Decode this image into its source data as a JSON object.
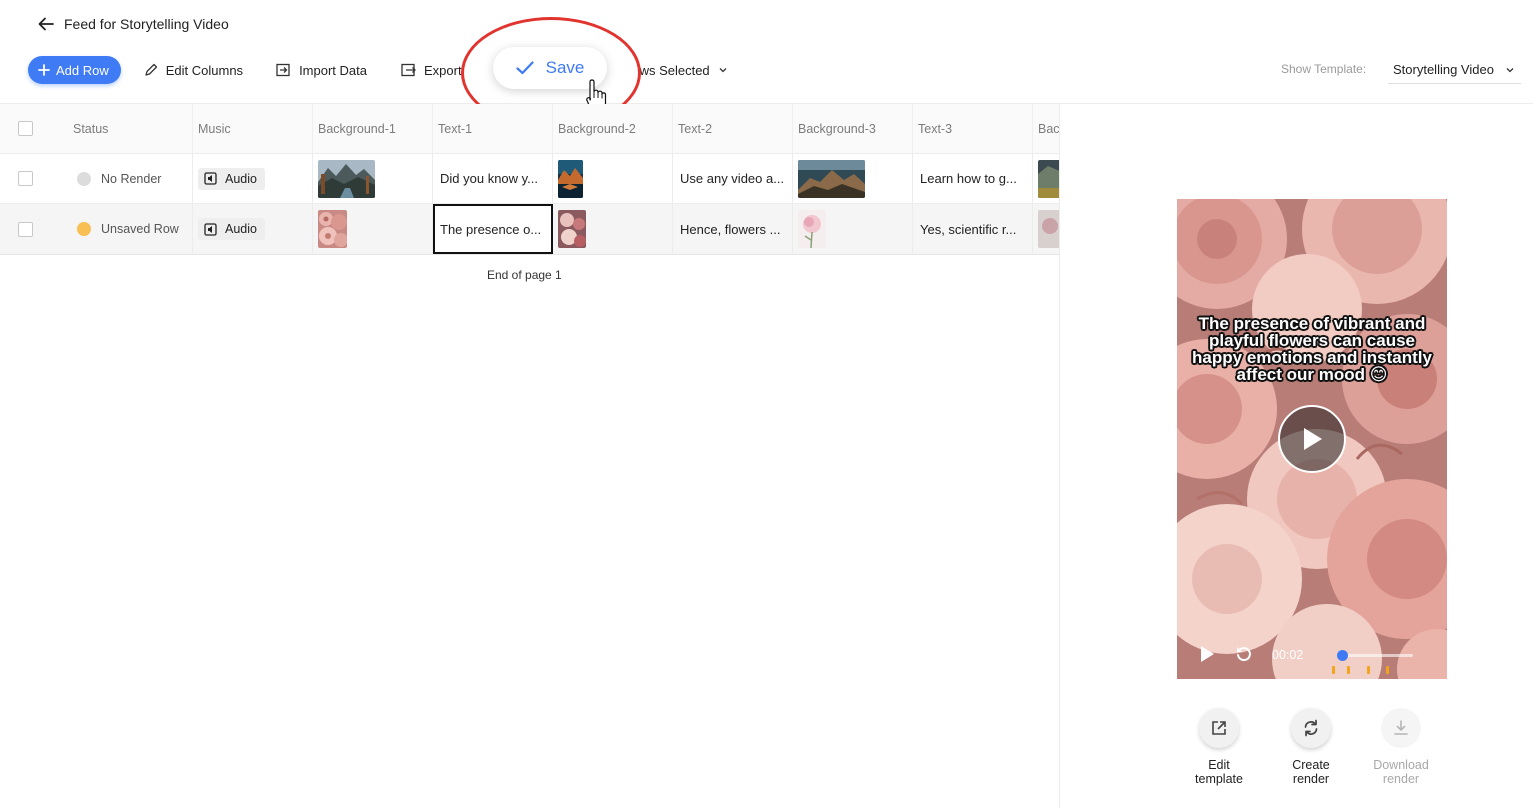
{
  "header": {
    "title": "Feed for Storytelling Video"
  },
  "toolbar": {
    "add_row": "Add Row",
    "edit_columns": "Edit Columns",
    "import_data": "Import Data",
    "export": "Export",
    "rows_selected_partial": "ws Selected",
    "save": "Save",
    "show_template_label": "Show Template:",
    "template_value": "Storytelling Video"
  },
  "table": {
    "columns": [
      "Status",
      "Music",
      "Background-1",
      "Text-1",
      "Background-2",
      "Text-2",
      "Background-3",
      "Text-3",
      "Bac"
    ],
    "rows": [
      {
        "status": "No Render",
        "status_color": "#dcdcdc",
        "music": "Audio",
        "text1": "Did you know y...",
        "text2": "Use any video a...",
        "text3": "Learn how to g..."
      },
      {
        "status": "Unsaved Row",
        "status_color": "#f8bf55",
        "music": "Audio",
        "text1": "The presence o...",
        "text2": "Hence, flowers ...",
        "text3": "Yes, scientific r..."
      }
    ],
    "end_of_page": "End of page 1"
  },
  "preview": {
    "caption": "The presence of vibrant and playful flowers can cause happy emotions and instantly affect our mood 😊",
    "time": "00:02",
    "progress": 0.07
  },
  "actions": {
    "edit_template": "Edit\ntemplate",
    "create_render": "Create\nrender",
    "download_render": "Download\nrender"
  },
  "colors": {
    "accent": "#3f7bf5",
    "highlight_ring": "#e1342f"
  }
}
